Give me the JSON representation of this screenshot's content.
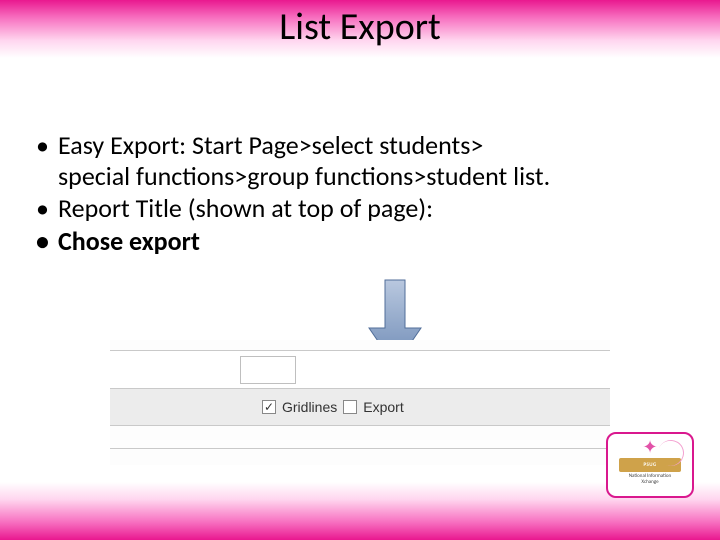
{
  "title": "List Export",
  "bullets": {
    "b1_line1": "Easy Export: Start Page>select students>",
    "b1_line2": "special functions>group functions>student list.",
    "b2": "Report Title (shown at top of page):",
    "b3": "Chose export"
  },
  "screenshot": {
    "gridlines_checked": true,
    "gridlines_label": "Gridlines",
    "export_checked": false,
    "export_label": "Export"
  },
  "logo": {
    "band": "PSUG",
    "sub1": "National Information",
    "sub2": "Xchange"
  },
  "colors": {
    "accent": "#e9188f",
    "arrow": "#7592bb"
  }
}
